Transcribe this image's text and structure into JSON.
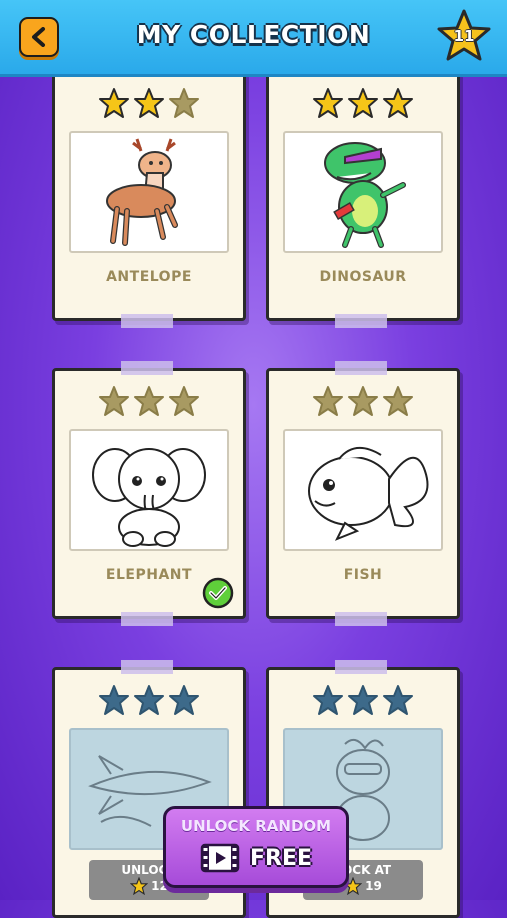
{
  "header": {
    "title": "MY COLLECTION",
    "star_count": "11"
  },
  "cards": [
    {
      "label": "ANTELOPE",
      "stars_earned": 2,
      "completed": false,
      "locked": false
    },
    {
      "label": "DINOSAUR",
      "stars_earned": 3,
      "completed": false,
      "locked": false
    },
    {
      "label": "ELEPHANT",
      "stars_earned": 0,
      "completed": true,
      "locked": false
    },
    {
      "label": "FISH",
      "stars_earned": 0,
      "completed": false,
      "locked": false
    },
    {
      "label": "ROCKET",
      "locked": true,
      "lock_text": "UNLOCK",
      "lock_cost": "12"
    },
    {
      "label": "RACCOON",
      "locked": true,
      "lock_text": "LOCK AT",
      "lock_cost": "19"
    }
  ],
  "unlock_button": {
    "line1": "UNLOCK RANDOM",
    "line2": "FREE"
  },
  "colors": {
    "star_gold": "#f5c518",
    "star_muted": "#a89a62",
    "star_locked": "#3d6a8a",
    "header_blue": "#2aa9ea",
    "button_purple": "#b55be0"
  }
}
